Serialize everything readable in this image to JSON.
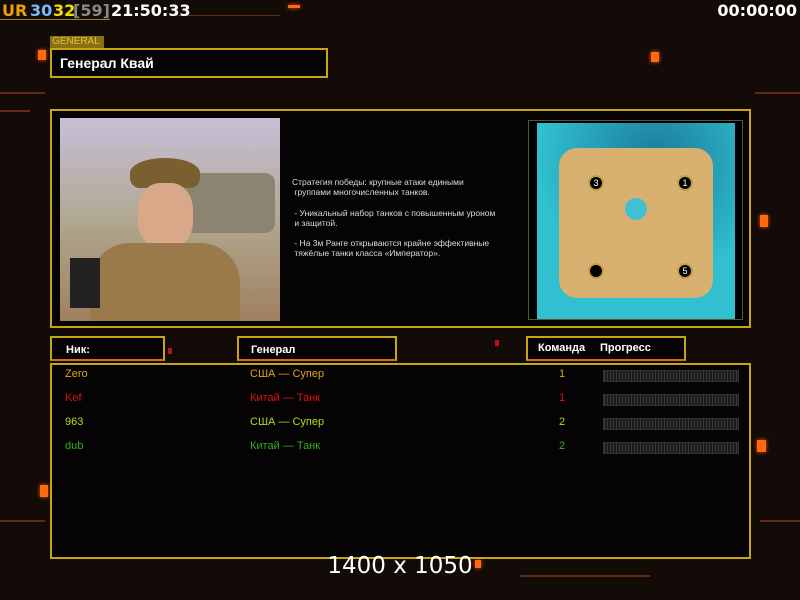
{
  "topbar": {
    "ur": "UR",
    "n1": "30",
    "n2": "32",
    "n3": "[59]",
    "clock": "21:50:33",
    "timer": "00:00:00"
  },
  "general": {
    "section_label": "GENERAL",
    "name": "Генерал Квай",
    "description": [
      "Стратегия победы: крупные атаки едиными",
      " группами многочисленных танков.",
      "",
      " - Уникальный набор танков с повышенным уроном",
      " и защитой.",
      "",
      " - На 3м Ранге открываются крайне эффективные",
      " тяжёлые танки класса «Император»."
    ]
  },
  "map": {
    "start_positions": [
      "3",
      "1",
      "5"
    ]
  },
  "table": {
    "headers": {
      "nick": "Ник:",
      "general": "Генерал",
      "team": "Команда",
      "progress": "Прогресс"
    },
    "rows": [
      {
        "nick": "Zero",
        "general": "США — Супер",
        "team": "1",
        "progress": 0,
        "color": "#e8a020"
      },
      {
        "nick": "Kef",
        "general": "Китай — Танк",
        "team": "1",
        "progress": 0,
        "color": "#e01010"
      },
      {
        "nick": "963",
        "general": "США — Супер",
        "team": "2",
        "progress": 0,
        "color": "#a8e020"
      },
      {
        "nick": "dub",
        "general": "Китай — Танк",
        "team": "2",
        "progress": 0,
        "color": "#30b020"
      }
    ]
  },
  "resolution": "1400 x 1050"
}
